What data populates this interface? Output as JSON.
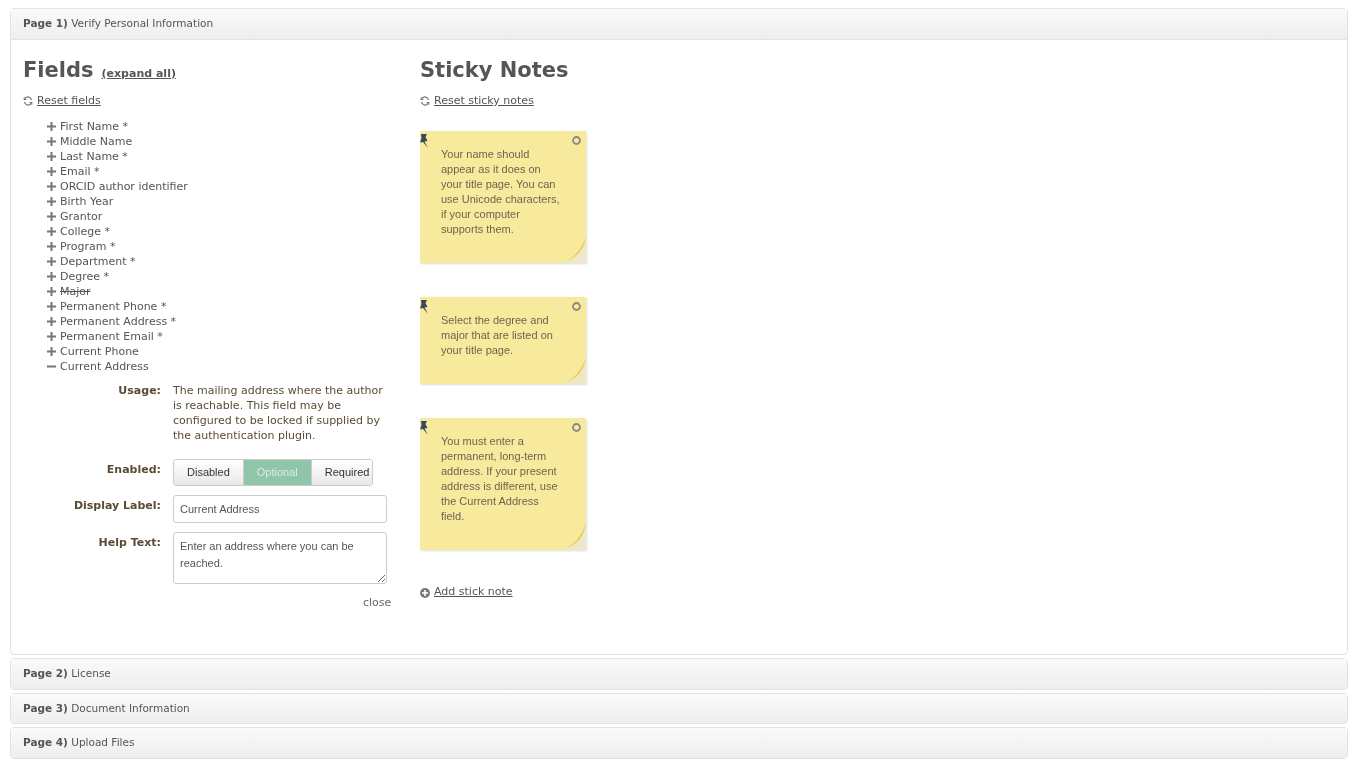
{
  "pages": [
    {
      "number": "Page 1)",
      "title": "Verify Personal Information",
      "expanded": true
    },
    {
      "number": "Page 2)",
      "title": "License",
      "expanded": false
    },
    {
      "number": "Page 3)",
      "title": "Document Information",
      "expanded": false
    },
    {
      "number": "Page 4)",
      "title": "Upload Files",
      "expanded": false
    }
  ],
  "fields_panel": {
    "heading": "Fields",
    "expand_all": "(expand all)",
    "reset": "Reset fields",
    "fields": [
      {
        "label": "First Name *",
        "expanded": false,
        "disabled": false
      },
      {
        "label": "Middle Name",
        "expanded": false,
        "disabled": false
      },
      {
        "label": "Last Name *",
        "expanded": false,
        "disabled": false
      },
      {
        "label": "Email *",
        "expanded": false,
        "disabled": false
      },
      {
        "label": "ORCID author identifier",
        "expanded": false,
        "disabled": false
      },
      {
        "label": "Birth Year",
        "expanded": false,
        "disabled": false
      },
      {
        "label": "Grantor",
        "expanded": false,
        "disabled": false
      },
      {
        "label": "College *",
        "expanded": false,
        "disabled": false
      },
      {
        "label": "Program *",
        "expanded": false,
        "disabled": false
      },
      {
        "label": "Department *",
        "expanded": false,
        "disabled": false
      },
      {
        "label": "Degree *",
        "expanded": false,
        "disabled": false
      },
      {
        "label": "Major",
        "expanded": false,
        "disabled": true
      },
      {
        "label": "Permanent Phone *",
        "expanded": false,
        "disabled": false
      },
      {
        "label": "Permanent Address *",
        "expanded": false,
        "disabled": false
      },
      {
        "label": "Permanent Email *",
        "expanded": false,
        "disabled": false
      },
      {
        "label": "Current Phone",
        "expanded": false,
        "disabled": false
      },
      {
        "label": "Current Address",
        "expanded": true,
        "disabled": false
      }
    ],
    "detail": {
      "usage_label": "Usage:",
      "usage": "The mailing address where the author is reachable. This field may be configured to be locked if supplied by the authentication plugin.",
      "enabled_label": "Enabled:",
      "options": [
        {
          "label": "Disabled",
          "selected": false
        },
        {
          "label": "Optional",
          "selected": true
        },
        {
          "label": "Required",
          "selected": false
        }
      ],
      "display_label_label": "Display Label:",
      "display_label": "Current Address",
      "help_text_label": "Help Text:",
      "help_text": "Enter an address where you can be reached.",
      "close": "close"
    }
  },
  "sticky_panel": {
    "heading": "Sticky Notes",
    "reset": "Reset sticky notes",
    "notes": [
      {
        "text": "Your name should appear as it does on your title page. You can use Unicode characters, if your computer supports them."
      },
      {
        "text": "Select the degree and major that are listed on your title page."
      },
      {
        "text": "You must enter a permanent, long-term address. If your present address is different, use the Current Address field."
      }
    ],
    "add": "Add stick note"
  }
}
